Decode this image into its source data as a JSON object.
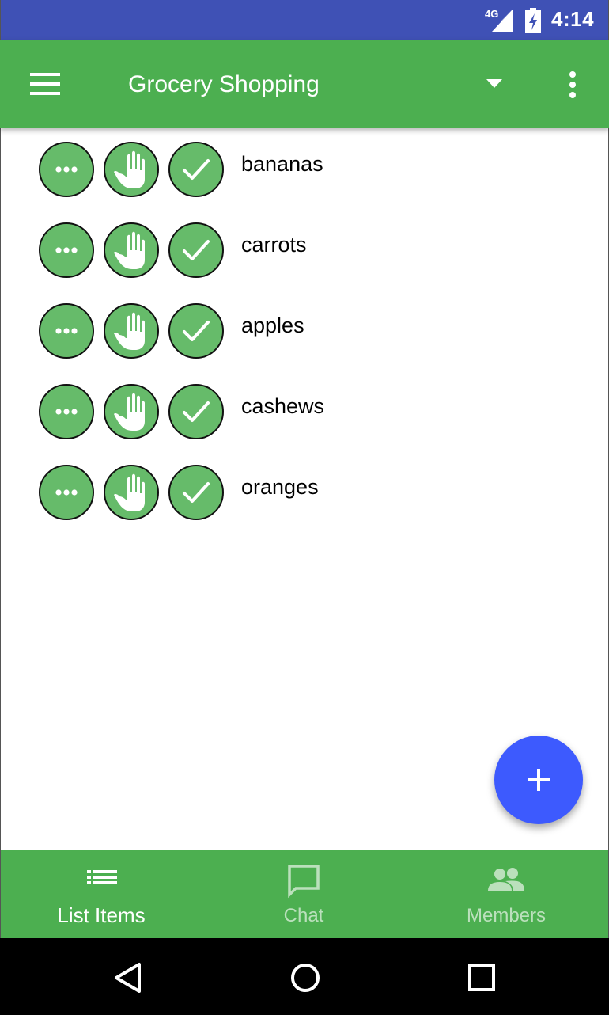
{
  "status_bar": {
    "network": "4G",
    "time": "4:14"
  },
  "toolbar": {
    "title": "Grocery Shopping"
  },
  "items": [
    {
      "name": "bananas"
    },
    {
      "name": "carrots"
    },
    {
      "name": "apples"
    },
    {
      "name": "cashews"
    },
    {
      "name": "oranges"
    }
  ],
  "bottom_nav": {
    "tabs": [
      {
        "label": "List Items",
        "icon": "list-icon",
        "active": true
      },
      {
        "label": "Chat",
        "icon": "chat-icon",
        "active": false
      },
      {
        "label": "Members",
        "icon": "people-icon",
        "active": false
      }
    ]
  },
  "fab": {
    "icon": "plus-icon"
  },
  "colors": {
    "status_bar": "#3F51B5",
    "primary": "#4CAF50",
    "item_button": "#66BB6A",
    "fab": "#3D5AFE"
  }
}
